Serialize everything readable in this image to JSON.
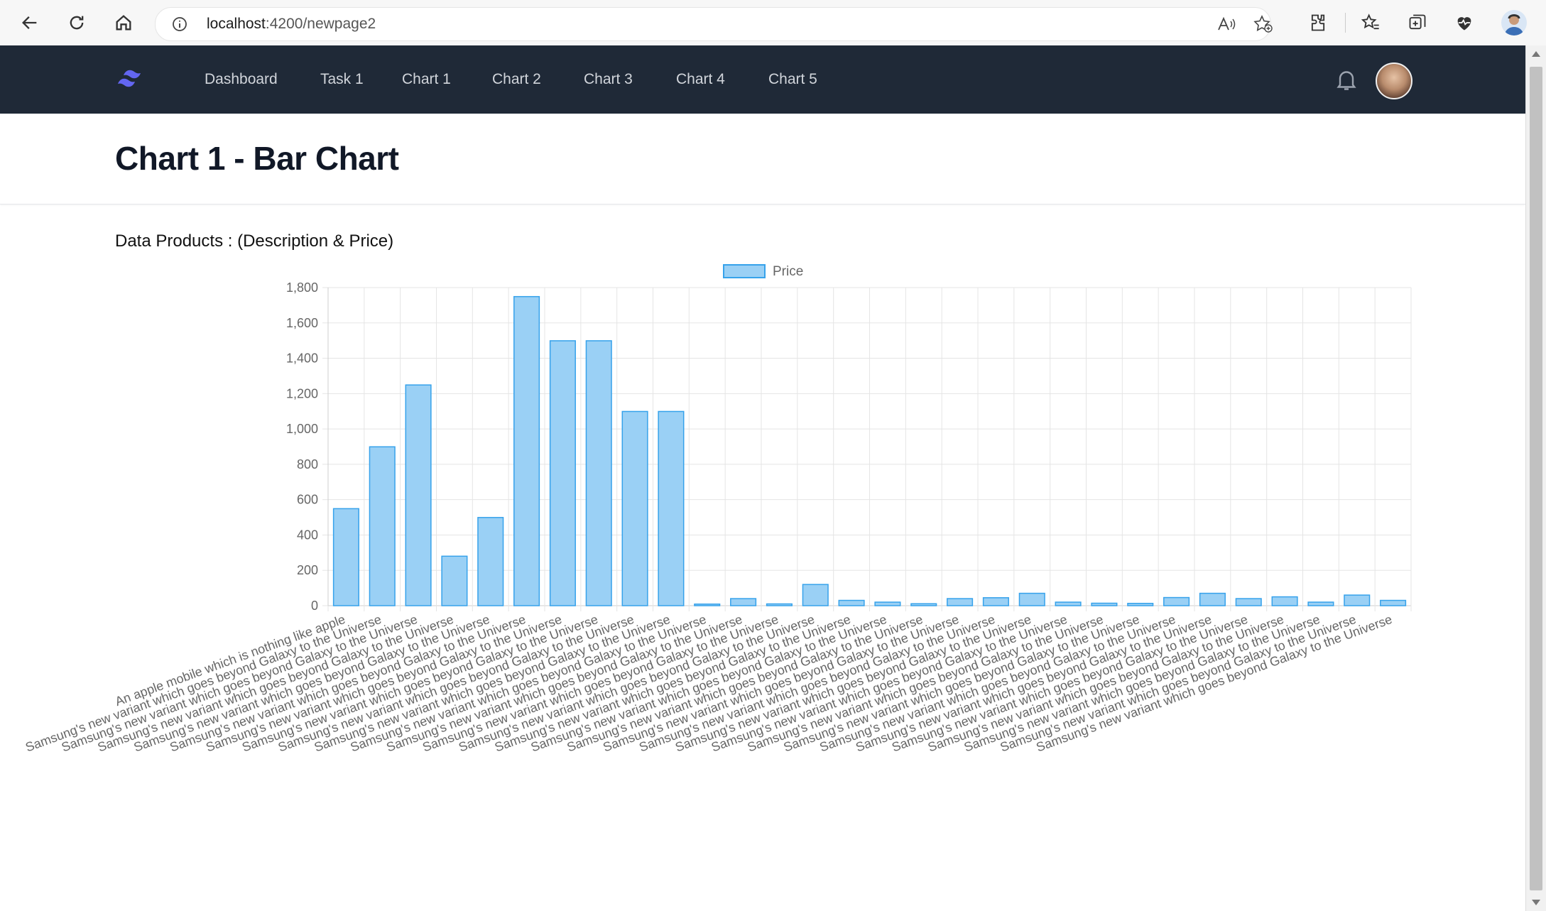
{
  "browser": {
    "url_host": "localhost",
    "url_path": ":4200/newpage2"
  },
  "navbar": {
    "items": [
      "Dashboard",
      "Task 1",
      "Chart 1",
      "Chart 2",
      "Chart 3",
      "Chart 4",
      "Chart 5"
    ],
    "accent": "#6366f1",
    "background": "#1f2937"
  },
  "page": {
    "title": "Chart 1 - Bar Chart",
    "subtitle": "Data Products : (Description & Price)"
  },
  "chart_data": {
    "type": "bar",
    "legend": "Price",
    "legend_position": "top",
    "grid": true,
    "bar_fill": "#9ad0f5",
    "bar_stroke": "#36a2eb",
    "ylim": [
      0,
      1800
    ],
    "yticks": [
      "0",
      "200",
      "400",
      "600",
      "800",
      "1,000",
      "1,200",
      "1,400",
      "1,600",
      "1,800"
    ],
    "categories": [
      "An apple mobile which is nothing like apple",
      "Samsung's new variant which goes beyond Galaxy to the Universe",
      "Samsung's new variant which goes beyond Galaxy to the Universe",
      "Samsung's new variant which goes beyond Galaxy to the Universe",
      "Samsung's new variant which goes beyond Galaxy to the Universe",
      "Samsung's new variant which goes beyond Galaxy to the Universe",
      "Samsung's new variant which goes beyond Galaxy to the Universe",
      "Samsung's new variant which goes beyond Galaxy to the Universe",
      "Samsung's new variant which goes beyond Galaxy to the Universe",
      "Samsung's new variant which goes beyond Galaxy to the Universe",
      "Samsung's new variant which goes beyond Galaxy to the Universe",
      "Samsung's new variant which goes beyond Galaxy to the Universe",
      "Samsung's new variant which goes beyond Galaxy to the Universe",
      "Samsung's new variant which goes beyond Galaxy to the Universe",
      "Samsung's new variant which goes beyond Galaxy to the Universe",
      "Samsung's new variant which goes beyond Galaxy to the Universe",
      "Samsung's new variant which goes beyond Galaxy to the Universe",
      "Samsung's new variant which goes beyond Galaxy to the Universe",
      "Samsung's new variant which goes beyond Galaxy to the Universe",
      "Samsung's new variant which goes beyond Galaxy to the Universe",
      "Samsung's new variant which goes beyond Galaxy to the Universe",
      "Samsung's new variant which goes beyond Galaxy to the Universe",
      "Samsung's new variant which goes beyond Galaxy to the Universe",
      "Samsung's new variant which goes beyond Galaxy to the Universe",
      "Samsung's new variant which goes beyond Galaxy to the Universe",
      "Samsung's new variant which goes beyond Galaxy to the Universe",
      "Samsung's new variant which goes beyond Galaxy to the Universe",
      "Samsung's new variant which goes beyond Galaxy to the Universe",
      "Samsung's new variant which goes beyond Galaxy to the Universe",
      "Samsung's new variant which goes beyond Galaxy to the Universe"
    ],
    "values": [
      549,
      899,
      1249,
      280,
      499,
      1749,
      1499,
      1499,
      1099,
      1099,
      9,
      40,
      10,
      120,
      30,
      20,
      11,
      40,
      45,
      70,
      20,
      14,
      13,
      46,
      70,
      40,
      50,
      20,
      60,
      30
    ]
  }
}
